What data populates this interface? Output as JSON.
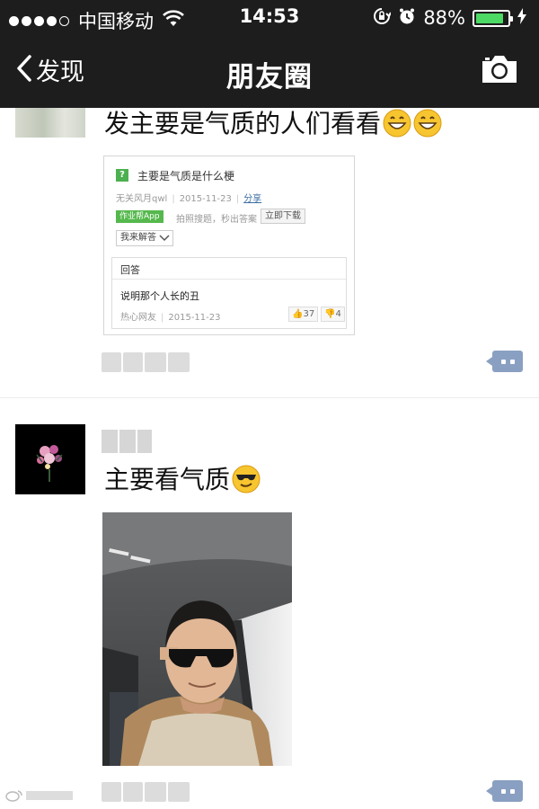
{
  "status_bar": {
    "carrier": "中国移动",
    "time": "14:53",
    "battery_percent": "88%",
    "battery_level": 0.88,
    "signal_bars_filled": 4,
    "signal_bars_total": 5
  },
  "nav": {
    "back_label": "发现",
    "title": "朋友圈"
  },
  "posts": [
    {
      "text": "发主要是气质的人们看看",
      "emoji_count": 2,
      "attachment": {
        "question_title": "主要是气质是什么梗",
        "author": "无关风月qwl",
        "date": "2015-11-23",
        "share_label": "分享",
        "app_badge": "作业帮App",
        "app_text": "拍照搜题，秒出答案",
        "download_label": "立即下载",
        "answer_button": "我来解答",
        "answer_header": "回答",
        "answer_text": "说明那个人长的丑",
        "answer_author": "热心网友",
        "answer_date": "2015-11-23",
        "likes": "37",
        "dislikes": "4"
      }
    },
    {
      "text": "主要看气质"
    }
  ],
  "colors": {
    "bar_background": "#1d1d1d",
    "battery_green": "#4cd964",
    "comment_button": "#8aa0c2"
  }
}
